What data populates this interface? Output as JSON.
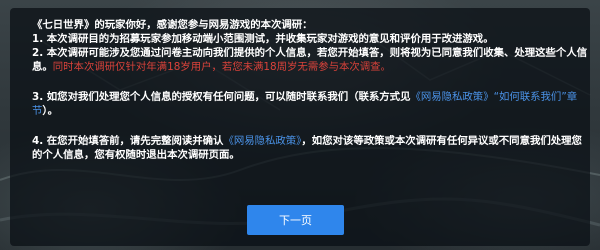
{
  "survey": {
    "greeting": "《七日世界》的玩家你好，感谢您参与网易游戏的本次调研：",
    "item1": "1. 本次调研目的为招募玩家参加移动端小范围测试，并收集玩家对游戏的意见和评价用于改进游戏。",
    "item2_prefix": "2. 本次调研可能涉及您通过问卷主动向我们提供的个人信息，若您开始填答，则将视为已同意我们收集、处理这些个人信息。",
    "item2_warning": "同时本次调研仅针对年满18岁用户，若您未满18周岁无需参与本次调查。",
    "item3_prefix": "3. 如您对我们处理您个人信息的授权有任何问题，可以随时联系我们（联系方式见",
    "item3_link": "《网易隐私政策》“如何联系我们”章节",
    "item3_suffix": "）。",
    "item4_prefix": "4. 在您开始填答前，请先完整阅读并确认",
    "item4_link": "《网易隐私政策》",
    "item4_suffix": "，如您对该等政策或本次调研有任何异议或不同意我们处理您的个人信息，您有权随时退出本次调研页面。"
  },
  "next_button_label": "下一页",
  "colors": {
    "warning": "#d9423a",
    "link": "#4b93e8",
    "button": "#2f86ec",
    "text": "#ffffff"
  }
}
